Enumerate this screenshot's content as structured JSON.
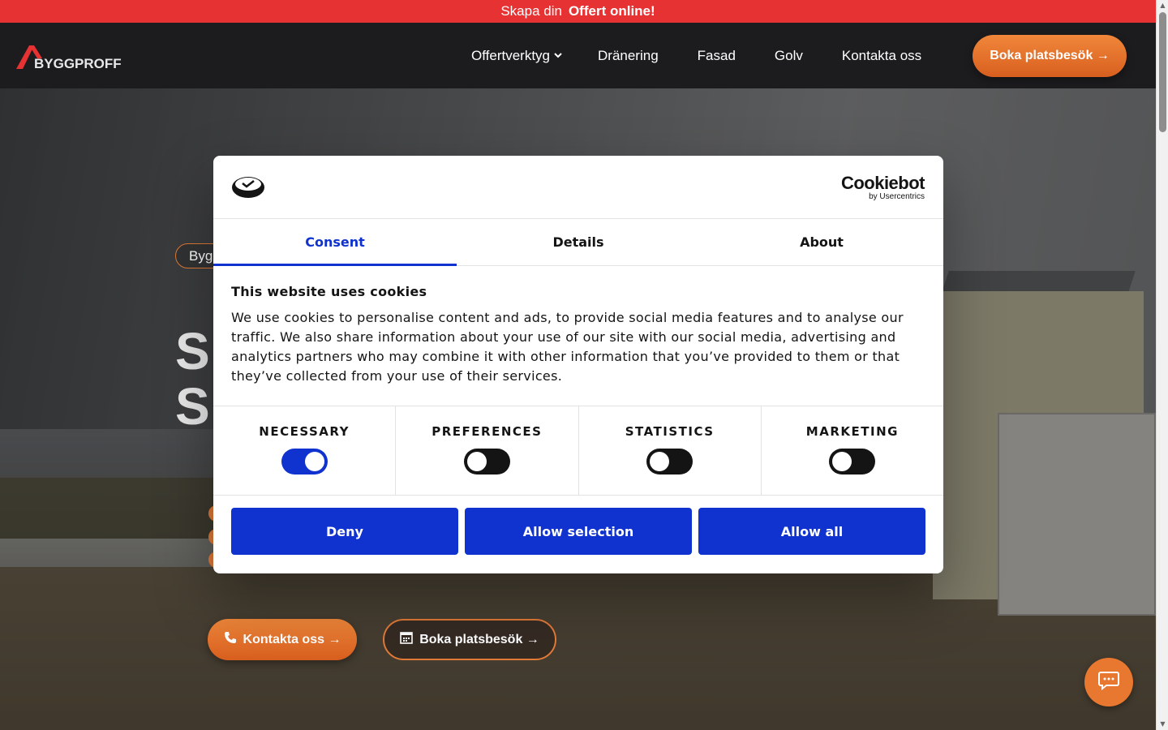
{
  "promo": {
    "text": "Skapa din",
    "link": "Offert online!"
  },
  "header": {
    "logo_text": "BYGGPROFFS",
    "nav": [
      {
        "label": "Offertverktyg",
        "icon": "chevron-down-icon"
      },
      {
        "label": "Dränering"
      },
      {
        "label": "Fasad"
      },
      {
        "label": "Golv"
      },
      {
        "label": "Kontakta oss"
      }
    ],
    "cta": "Boka platsbesök →"
  },
  "hero": {
    "tag": "Byg",
    "title_lines": [
      "S",
      "S"
    ],
    "btn_contact": "Kontakta oss →",
    "btn_book": "Boka platsbesök →"
  },
  "cookie_dialog": {
    "brand": "Cookiebot",
    "brand_sub": "by Usercentrics",
    "tabs": [
      "Consent",
      "Details",
      "About"
    ],
    "active_tab": "Consent",
    "heading": "This website uses cookies",
    "body": "We use cookies to personalise content and ads, to provide social media features and to analyse our traffic. We also share information about your use of our site with our social media, advertising and analytics partners who may combine it with other information that you’ve provided to them or that they’ve collected from your use of their services.",
    "toggles": [
      {
        "label": "NECESSARY",
        "on": true
      },
      {
        "label": "PREFERENCES",
        "on": false
      },
      {
        "label": "STATISTICS",
        "on": false
      },
      {
        "label": "MARKETING",
        "on": false
      }
    ],
    "buttons": [
      "Deny",
      "Allow selection",
      "Allow all"
    ],
    "accent": "#1032cf"
  },
  "colors": {
    "brand_orange": "#e8772f",
    "promo_red": "#e63232",
    "header_bg": "#1c1c1e"
  }
}
